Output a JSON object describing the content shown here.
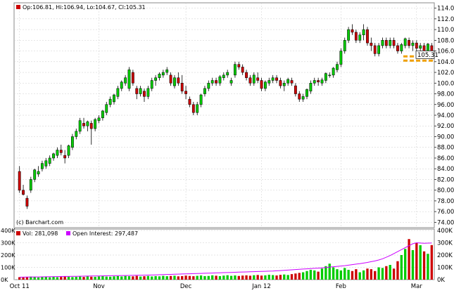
{
  "header": {
    "ohlc_text": "Op:106.81, Hi:106.94, Lo:104.67, Cl:105.31",
    "watermark": "(c) Barchart.com",
    "last_price_label": "105.31",
    "volume_legend": "Vol: 281,098",
    "oi_legend": "Open Interest: 297,487"
  },
  "colors": {
    "up": "#00cc00",
    "down": "#cc0000",
    "wick": "#000000",
    "oi_line": "#cc00ff",
    "support_band": "#f0a000",
    "grid": "#cccccc",
    "background": "#ffffff"
  },
  "chart_data": [
    {
      "type": "candlestick",
      "price_axis": {
        "ylim": [
          73,
          115
        ],
        "tick_labels": [
          "114.00",
          "112.00",
          "110.00",
          "108.00",
          "106.00",
          "104.00",
          "102.00",
          "100.00",
          "98.00",
          "96.00",
          "94.00",
          "92.00",
          "90.00",
          "88.00",
          "86.00",
          "84.00",
          "82.00",
          "80.00",
          "78.00",
          "76.00",
          "74.00"
        ],
        "ticks": [
          114,
          112,
          110,
          108,
          106,
          104,
          102,
          100,
          98,
          96,
          94,
          92,
          90,
          88,
          86,
          84,
          82,
          80,
          78,
          76,
          74
        ]
      },
      "x_labels": [
        "Oct 11",
        "Nov",
        "Dec",
        "Jan 12",
        "Feb",
        "Mar"
      ],
      "x_label_positions": [
        0,
        21,
        44,
        64,
        85,
        105
      ],
      "support_band": [
        104.2,
        105.0
      ],
      "support_band_start": 102,
      "candles": [
        [
          83.5,
          84.5,
          79.5,
          80.0
        ],
        [
          80.0,
          81.0,
          79.0,
          79.2
        ],
        [
          78.5,
          79.0,
          76.5,
          77.0
        ],
        [
          80.0,
          82.5,
          79.5,
          82.0
        ],
        [
          82.0,
          84.0,
          81.5,
          83.8
        ],
        [
          83.0,
          84.5,
          82.5,
          83.5
        ],
        [
          84.0,
          85.5,
          83.5,
          85.0
        ],
        [
          84.5,
          86.0,
          84.0,
          85.5
        ],
        [
          85.0,
          86.5,
          84.5,
          86.0
        ],
        [
          86.0,
          87.0,
          85.5,
          86.8
        ],
        [
          86.5,
          88.0,
          86.0,
          87.5
        ],
        [
          87.5,
          88.5,
          86.5,
          87.0
        ],
        [
          86.5,
          87.5,
          85.0,
          86.0
        ],
        [
          86.5,
          88.5,
          86.0,
          88.3
        ],
        [
          88.0,
          90.5,
          87.5,
          90.0
        ],
        [
          90.0,
          91.5,
          89.5,
          91.0
        ],
        [
          91.0,
          93.5,
          90.5,
          93.0
        ],
        [
          92.5,
          93.5,
          91.5,
          92.0
        ],
        [
          92.0,
          93.0,
          91.0,
          92.8
        ],
        [
          92.5,
          93.0,
          88.5,
          91.5
        ],
        [
          91.5,
          93.5,
          91.0,
          93.2
        ],
        [
          93.0,
          94.0,
          92.5,
          93.5
        ],
        [
          93.5,
          95.0,
          93.0,
          94.8
        ],
        [
          94.5,
          96.5,
          94.0,
          96.0
        ],
        [
          96.0,
          97.5,
          95.5,
          97.0
        ],
        [
          96.5,
          98.0,
          96.0,
          97.8
        ],
        [
          97.5,
          99.5,
          97.0,
          99.0
        ],
        [
          99.0,
          100.5,
          98.5,
          100.2
        ],
        [
          100.0,
          101.5,
          99.5,
          101.0
        ],
        [
          99.0,
          103.0,
          98.5,
          102.5
        ],
        [
          102.0,
          102.5,
          99.5,
          100.0
        ],
        [
          99.0,
          99.5,
          97.0,
          98.0
        ],
        [
          98.0,
          99.5,
          97.5,
          99.0
        ],
        [
          98.5,
          99.0,
          96.5,
          97.5
        ],
        [
          97.5,
          99.5,
          97.0,
          99.0
        ],
        [
          99.0,
          101.0,
          98.5,
          100.5
        ],
        [
          100.5,
          101.5,
          99.5,
          101.0
        ],
        [
          101.0,
          102.0,
          100.5,
          101.7
        ],
        [
          101.5,
          102.5,
          101.0,
          102.0
        ],
        [
          102.0,
          103.0,
          101.5,
          102.5
        ],
        [
          101.5,
          102.0,
          99.5,
          100.0
        ],
        [
          99.5,
          101.5,
          99.0,
          101.0
        ],
        [
          101.0,
          102.0,
          99.5,
          100.0
        ],
        [
          100.0,
          101.5,
          98.0,
          98.5
        ],
        [
          98.5,
          99.5,
          97.0,
          98.0
        ],
        [
          97.0,
          97.5,
          95.5,
          96.0
        ],
        [
          96.0,
          96.5,
          94.0,
          94.5
        ],
        [
          94.5,
          96.5,
          94.0,
          96.0
        ],
        [
          96.0,
          98.0,
          95.5,
          97.8
        ],
        [
          98.0,
          99.5,
          97.5,
          99.0
        ],
        [
          99.0,
          100.5,
          98.5,
          100.0
        ],
        [
          100.0,
          101.0,
          99.5,
          100.5
        ],
        [
          100.5,
          101.0,
          99.5,
          100.0
        ],
        [
          100.0,
          101.5,
          99.5,
          101.2
        ],
        [
          101.0,
          102.0,
          100.5,
          101.5
        ],
        [
          101.5,
          102.5,
          101.0,
          102.0
        ],
        [
          100.0,
          101.0,
          99.5,
          100.5
        ],
        [
          101.5,
          104.0,
          101.0,
          103.5
        ],
        [
          103.5,
          104.0,
          102.5,
          103.0
        ],
        [
          103.0,
          103.5,
          101.5,
          102.0
        ],
        [
          102.0,
          102.5,
          100.5,
          101.0
        ],
        [
          101.0,
          101.5,
          99.5,
          100.0
        ],
        [
          100.0,
          102.0,
          99.5,
          101.5
        ],
        [
          101.0,
          102.0,
          100.0,
          100.5
        ],
        [
          100.5,
          101.0,
          98.5,
          99.0
        ],
        [
          99.0,
          100.5,
          98.5,
          100.2
        ],
        [
          100.0,
          101.0,
          99.5,
          100.5
        ],
        [
          100.5,
          101.5,
          100.0,
          101.0
        ],
        [
          101.0,
          101.5,
          100.0,
          100.5
        ],
        [
          100.5,
          101.0,
          99.0,
          99.5
        ],
        [
          99.5,
          100.5,
          98.5,
          100.0
        ],
        [
          100.0,
          101.0,
          99.5,
          100.7
        ],
        [
          100.5,
          101.0,
          99.5,
          100.0
        ],
        [
          99.5,
          100.0,
          97.5,
          98.0
        ],
        [
          98.0,
          98.5,
          96.5,
          97.0
        ],
        [
          97.0,
          98.0,
          96.5,
          97.5
        ],
        [
          97.5,
          99.0,
          97.0,
          98.8
        ],
        [
          98.5,
          100.5,
          98.0,
          100.0
        ],
        [
          100.0,
          101.0,
          99.5,
          100.5
        ],
        [
          100.5,
          101.0,
          99.5,
          100.2
        ],
        [
          100.0,
          101.0,
          99.5,
          100.6
        ],
        [
          100.5,
          102.0,
          100.0,
          101.8
        ],
        [
          101.5,
          102.0,
          101.0,
          101.5
        ],
        [
          101.5,
          103.0,
          101.0,
          102.8
        ],
        [
          102.5,
          104.0,
          102.0,
          103.5
        ],
        [
          103.5,
          106.5,
          103.0,
          106.0
        ],
        [
          106.0,
          108.5,
          105.5,
          108.0
        ],
        [
          108.0,
          110.5,
          107.5,
          110.0
        ],
        [
          110.0,
          111.0,
          109.0,
          109.5
        ],
        [
          109.5,
          110.0,
          107.5,
          108.0
        ],
        [
          108.0,
          109.5,
          107.5,
          109.0
        ],
        [
          109.0,
          111.0,
          108.0,
          110.0
        ],
        [
          110.0,
          110.5,
          107.0,
          107.5
        ],
        [
          107.5,
          108.5,
          106.0,
          107.0
        ],
        [
          107.0,
          107.5,
          105.0,
          105.5
        ],
        [
          105.5,
          107.5,
          105.0,
          107.0
        ],
        [
          107.0,
          108.5,
          106.5,
          108.0
        ],
        [
          108.0,
          108.5,
          106.5,
          107.0
        ],
        [
          107.0,
          108.5,
          106.5,
          108.0
        ],
        [
          108.0,
          108.5,
          106.5,
          107.0
        ],
        [
          107.0,
          107.5,
          105.5,
          106.0
        ],
        [
          106.0,
          107.5,
          105.5,
          107.2
        ],
        [
          107.0,
          108.5,
          106.5,
          108.3
        ],
        [
          108.0,
          108.5,
          106.5,
          107.0
        ],
        [
          107.0,
          108.0,
          106.0,
          107.5
        ],
        [
          107.5,
          108.0,
          106.0,
          106.5
        ],
        [
          106.5,
          107.5,
          105.5,
          107.0
        ],
        [
          107.0,
          107.5,
          105.5,
          106.0
        ],
        [
          106.0,
          107.5,
          105.5,
          107.3
        ],
        [
          107.0,
          107.5,
          104.5,
          105.31
        ]
      ]
    },
    {
      "type": "bar",
      "name": "Vol",
      "ylim": [
        0,
        400000
      ],
      "tick_labels": [
        "400K",
        "300K",
        "200K",
        "100K",
        "0K"
      ],
      "ticks": [
        400000,
        300000,
        200000,
        100000,
        0
      ],
      "values": [
        20000,
        18000,
        22000,
        25000,
        20000,
        18000,
        21000,
        24000,
        19000,
        23000,
        20000,
        22000,
        26000,
        24000,
        21000,
        23000,
        25000,
        22000,
        27000,
        24000,
        23000,
        26000,
        28000,
        25000,
        24000,
        27000,
        29000,
        26000,
        30000,
        28000,
        27000,
        31000,
        25000,
        28000,
        30000,
        26000,
        29000,
        27000,
        31000,
        28000,
        30000,
        32000,
        27000,
        29000,
        33000,
        30000,
        28000,
        31000,
        34000,
        29000,
        30000,
        35000,
        32000,
        29000,
        33000,
        36000,
        31000,
        34000,
        30000,
        33000,
        35000,
        32000,
        36000,
        38000,
        33000,
        35000,
        40000,
        37000,
        34000,
        39000,
        42000,
        38000,
        45000,
        50000,
        55000,
        60000,
        70000,
        80000,
        75000,
        65000,
        90000,
        110000,
        130000,
        100000,
        85000,
        75000,
        95000,
        80000,
        70000,
        85000,
        60000,
        75000,
        90000,
        85000,
        70000,
        100000,
        95000,
        110000,
        120000,
        90000,
        150000,
        200000,
        250000,
        330000,
        240000,
        300000,
        280000,
        230000,
        210000,
        281098
      ]
    },
    {
      "type": "line",
      "name": "Open Interest",
      "values": [
        20000,
        20500,
        21000,
        21500,
        22000,
        22500,
        23000,
        23500,
        24000,
        24500,
        25000,
        25500,
        26000,
        26500,
        27000,
        27500,
        28000,
        28500,
        29000,
        29500,
        30000,
        30500,
        31000,
        31500,
        32000,
        32500,
        33000,
        33500,
        34000,
        34500,
        35000,
        35500,
        36000,
        36500,
        37000,
        38000,
        39000,
        40000,
        41000,
        42000,
        43000,
        44000,
        45000,
        46000,
        47000,
        48000,
        49000,
        50000,
        51000,
        52000,
        53000,
        54000,
        55000,
        56000,
        57000,
        58000,
        59000,
        60000,
        61000,
        62000,
        63000,
        64000,
        65000,
        66000,
        67000,
        68000,
        69000,
        70000,
        72000,
        74000,
        76000,
        78000,
        80000,
        82000,
        84000,
        86000,
        88000,
        90000,
        92000,
        94000,
        96000,
        99000,
        102000,
        105000,
        108000,
        111000,
        114000,
        118000,
        122000,
        126000,
        130000,
        135000,
        140000,
        146000,
        152000,
        160000,
        170000,
        182000,
        196000,
        212000,
        228000,
        244000,
        260000,
        276000,
        292000,
        300000,
        298000,
        296000,
        297000,
        297487
      ]
    }
  ]
}
